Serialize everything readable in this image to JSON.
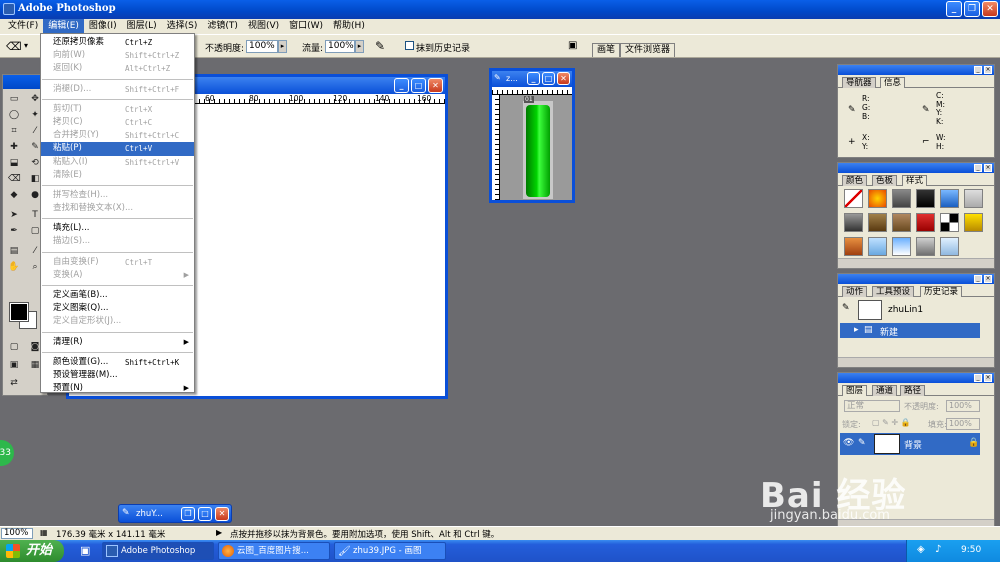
{
  "app": {
    "title": "Adobe Photoshop"
  },
  "menubar": {
    "items": [
      "文件(F)",
      "编辑(E)",
      "图像(I)",
      "图层(L)",
      "选择(S)",
      "滤镜(T)",
      "视图(V)",
      "窗口(W)",
      "帮助(H)"
    ],
    "active_index": 1
  },
  "options": {
    "opacity_label": "不透明度:",
    "opacity_value": "100%",
    "flow_label": "流量:",
    "flow_value": "100%",
    "erase_history_label": "抹到历史记录",
    "well_tabs": [
      "画笔",
      "文件浏览器"
    ]
  },
  "edit_menu": {
    "items": [
      {
        "label": "还原拷贝像素",
        "shortcut": "Ctrl+Z",
        "disabled": false
      },
      {
        "label": "向前(W)",
        "shortcut": "Shift+Ctrl+Z",
        "disabled": true
      },
      {
        "label": "返回(K)",
        "shortcut": "Alt+Ctrl+Z",
        "disabled": true
      },
      {
        "sep": true
      },
      {
        "label": "消褪(D)...",
        "shortcut": "Shift+Ctrl+F",
        "disabled": true
      },
      {
        "sep": true
      },
      {
        "label": "剪切(T)",
        "shortcut": "Ctrl+X",
        "disabled": true
      },
      {
        "label": "拷贝(C)",
        "shortcut": "Ctrl+C",
        "disabled": true
      },
      {
        "label": "合并拷贝(Y)",
        "shortcut": "Shift+Ctrl+C",
        "disabled": true
      },
      {
        "label": "粘贴(P)",
        "shortcut": "Ctrl+V",
        "disabled": false,
        "highlighted": true
      },
      {
        "label": "粘贴入(I)",
        "shortcut": "Shift+Ctrl+V",
        "disabled": true
      },
      {
        "label": "清除(E)",
        "shortcut": "",
        "disabled": true
      },
      {
        "sep": true
      },
      {
        "label": "拼写检查(H)...",
        "shortcut": "",
        "disabled": true
      },
      {
        "label": "查找和替换文本(X)...",
        "shortcut": "",
        "disabled": true
      },
      {
        "sep": true
      },
      {
        "label": "填充(L)...",
        "shortcut": "",
        "disabled": false
      },
      {
        "label": "描边(S)...",
        "shortcut": "",
        "disabled": true
      },
      {
        "sep": true
      },
      {
        "label": "自由变换(F)",
        "shortcut": "Ctrl+T",
        "disabled": true
      },
      {
        "label": "变换(A)",
        "shortcut": "",
        "disabled": true,
        "submenu": true
      },
      {
        "sep": true
      },
      {
        "label": "定义画笔(B)...",
        "shortcut": "",
        "disabled": false
      },
      {
        "label": "定义图案(Q)...",
        "shortcut": "",
        "disabled": false
      },
      {
        "label": "定义自定形状(J)...",
        "shortcut": "",
        "disabled": true
      },
      {
        "sep": true
      },
      {
        "label": "清理(R)",
        "shortcut": "",
        "disabled": false,
        "submenu": true
      },
      {
        "sep": true
      },
      {
        "label": "颜色设置(G)...",
        "shortcut": "Shift+Ctrl+K",
        "disabled": false
      },
      {
        "label": "预设管理器(M)...",
        "shortcut": "",
        "disabled": false
      },
      {
        "label": "预置(N)",
        "shortcut": "",
        "disabled": false,
        "submenu": true
      }
    ]
  },
  "doc_main": {
    "ruler_labels": [
      "60",
      "80",
      "100",
      "120",
      "140",
      "160"
    ]
  },
  "doc_small": {
    "title": "z...",
    "layer_label": "01"
  },
  "doc_min": {
    "title": "zhuY..."
  },
  "navigator": {
    "tabs": [
      "导航器",
      "信息"
    ],
    "rgb": "R:\nG:\nB:",
    "cmyk": "C:\nM:\nY:\nK:",
    "xy": "X:\nY:",
    "wh": "W:\nH:"
  },
  "color_palette": {
    "tabs": [
      "颜色",
      "色板",
      "样式"
    ]
  },
  "history": {
    "tabs": [
      "动作",
      "工具预设",
      "历史记录"
    ],
    "snapshot": "zhuLin1",
    "state": "新建"
  },
  "layers": {
    "tabs": [
      "图层",
      "通道",
      "路径"
    ],
    "blend_mode": "正常",
    "opacity_label": "不透明度:",
    "opacity_value": "100%",
    "lock_label": "锁定:",
    "fill_label": "填充:",
    "fill_value": "100%",
    "layer_name": "背景"
  },
  "status": {
    "zoom": "100%",
    "doc_size": "176.39 毫米 x 141.11 毫米",
    "hint": "点按并拖移以抹为背景色。要用附加选项，使用 Shift、Alt 和 Ctrl 键。"
  },
  "taskbar": {
    "start_label": "开始",
    "tasks": [
      "Adobe Photoshop",
      "云图_百度图片搜...",
      "zhu39.JPG - 画图"
    ],
    "clock": "9:50"
  },
  "overlay": {
    "badge": "33",
    "watermark": "Bai 经验",
    "watermark_url": "jingyan.baidu.com"
  },
  "colors": {
    "accent": "#316ac5",
    "titlebar": "#0a4fd8",
    "workspace": "#6b6b6f",
    "green_fill": "#00c000"
  }
}
